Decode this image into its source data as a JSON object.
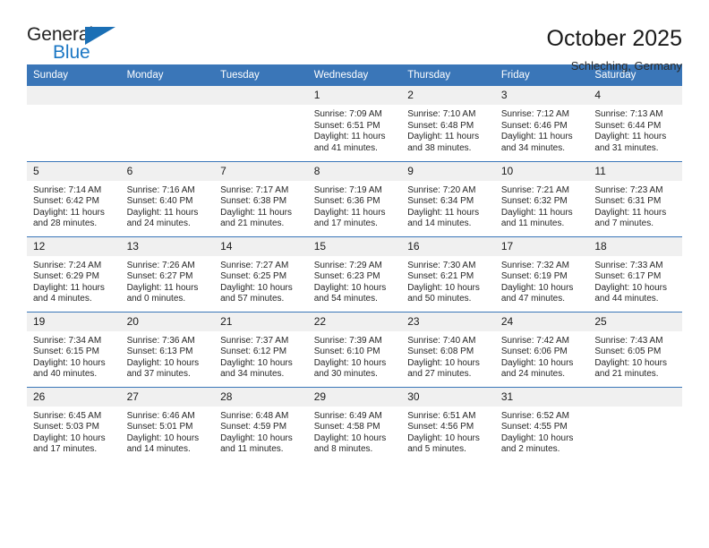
{
  "brand": {
    "name_top": "General",
    "name_bottom": "Blue",
    "flag_icon": "triangle-flag-icon",
    "color_top": "#222222",
    "color_bottom": "#1b77c4",
    "accent": "#3a76b8"
  },
  "header": {
    "month_title": "October 2025",
    "location": "Schleching, Germany"
  },
  "calendar": {
    "weekday_headers": [
      "Sunday",
      "Monday",
      "Tuesday",
      "Wednesday",
      "Thursday",
      "Friday",
      "Saturday"
    ],
    "header_bg": "#3a76b8",
    "daynum_bg": "#f0f0f0",
    "weeks": [
      [
        {
          "blank": true
        },
        {
          "blank": true
        },
        {
          "blank": true
        },
        {
          "day": "1",
          "sunrise": "Sunrise: 7:09 AM",
          "sunset": "Sunset: 6:51 PM",
          "daylight_1": "Daylight: 11 hours",
          "daylight_2": "and 41 minutes."
        },
        {
          "day": "2",
          "sunrise": "Sunrise: 7:10 AM",
          "sunset": "Sunset: 6:48 PM",
          "daylight_1": "Daylight: 11 hours",
          "daylight_2": "and 38 minutes."
        },
        {
          "day": "3",
          "sunrise": "Sunrise: 7:12 AM",
          "sunset": "Sunset: 6:46 PM",
          "daylight_1": "Daylight: 11 hours",
          "daylight_2": "and 34 minutes."
        },
        {
          "day": "4",
          "sunrise": "Sunrise: 7:13 AM",
          "sunset": "Sunset: 6:44 PM",
          "daylight_1": "Daylight: 11 hours",
          "daylight_2": "and 31 minutes."
        }
      ],
      [
        {
          "day": "5",
          "sunrise": "Sunrise: 7:14 AM",
          "sunset": "Sunset: 6:42 PM",
          "daylight_1": "Daylight: 11 hours",
          "daylight_2": "and 28 minutes."
        },
        {
          "day": "6",
          "sunrise": "Sunrise: 7:16 AM",
          "sunset": "Sunset: 6:40 PM",
          "daylight_1": "Daylight: 11 hours",
          "daylight_2": "and 24 minutes."
        },
        {
          "day": "7",
          "sunrise": "Sunrise: 7:17 AM",
          "sunset": "Sunset: 6:38 PM",
          "daylight_1": "Daylight: 11 hours",
          "daylight_2": "and 21 minutes."
        },
        {
          "day": "8",
          "sunrise": "Sunrise: 7:19 AM",
          "sunset": "Sunset: 6:36 PM",
          "daylight_1": "Daylight: 11 hours",
          "daylight_2": "and 17 minutes."
        },
        {
          "day": "9",
          "sunrise": "Sunrise: 7:20 AM",
          "sunset": "Sunset: 6:34 PM",
          "daylight_1": "Daylight: 11 hours",
          "daylight_2": "and 14 minutes."
        },
        {
          "day": "10",
          "sunrise": "Sunrise: 7:21 AM",
          "sunset": "Sunset: 6:32 PM",
          "daylight_1": "Daylight: 11 hours",
          "daylight_2": "and 11 minutes."
        },
        {
          "day": "11",
          "sunrise": "Sunrise: 7:23 AM",
          "sunset": "Sunset: 6:31 PM",
          "daylight_1": "Daylight: 11 hours",
          "daylight_2": "and 7 minutes."
        }
      ],
      [
        {
          "day": "12",
          "sunrise": "Sunrise: 7:24 AM",
          "sunset": "Sunset: 6:29 PM",
          "daylight_1": "Daylight: 11 hours",
          "daylight_2": "and 4 minutes."
        },
        {
          "day": "13",
          "sunrise": "Sunrise: 7:26 AM",
          "sunset": "Sunset: 6:27 PM",
          "daylight_1": "Daylight: 11 hours",
          "daylight_2": "and 0 minutes."
        },
        {
          "day": "14",
          "sunrise": "Sunrise: 7:27 AM",
          "sunset": "Sunset: 6:25 PM",
          "daylight_1": "Daylight: 10 hours",
          "daylight_2": "and 57 minutes."
        },
        {
          "day": "15",
          "sunrise": "Sunrise: 7:29 AM",
          "sunset": "Sunset: 6:23 PM",
          "daylight_1": "Daylight: 10 hours",
          "daylight_2": "and 54 minutes."
        },
        {
          "day": "16",
          "sunrise": "Sunrise: 7:30 AM",
          "sunset": "Sunset: 6:21 PM",
          "daylight_1": "Daylight: 10 hours",
          "daylight_2": "and 50 minutes."
        },
        {
          "day": "17",
          "sunrise": "Sunrise: 7:32 AM",
          "sunset": "Sunset: 6:19 PM",
          "daylight_1": "Daylight: 10 hours",
          "daylight_2": "and 47 minutes."
        },
        {
          "day": "18",
          "sunrise": "Sunrise: 7:33 AM",
          "sunset": "Sunset: 6:17 PM",
          "daylight_1": "Daylight: 10 hours",
          "daylight_2": "and 44 minutes."
        }
      ],
      [
        {
          "day": "19",
          "sunrise": "Sunrise: 7:34 AM",
          "sunset": "Sunset: 6:15 PM",
          "daylight_1": "Daylight: 10 hours",
          "daylight_2": "and 40 minutes."
        },
        {
          "day": "20",
          "sunrise": "Sunrise: 7:36 AM",
          "sunset": "Sunset: 6:13 PM",
          "daylight_1": "Daylight: 10 hours",
          "daylight_2": "and 37 minutes."
        },
        {
          "day": "21",
          "sunrise": "Sunrise: 7:37 AM",
          "sunset": "Sunset: 6:12 PM",
          "daylight_1": "Daylight: 10 hours",
          "daylight_2": "and 34 minutes."
        },
        {
          "day": "22",
          "sunrise": "Sunrise: 7:39 AM",
          "sunset": "Sunset: 6:10 PM",
          "daylight_1": "Daylight: 10 hours",
          "daylight_2": "and 30 minutes."
        },
        {
          "day": "23",
          "sunrise": "Sunrise: 7:40 AM",
          "sunset": "Sunset: 6:08 PM",
          "daylight_1": "Daylight: 10 hours",
          "daylight_2": "and 27 minutes."
        },
        {
          "day": "24",
          "sunrise": "Sunrise: 7:42 AM",
          "sunset": "Sunset: 6:06 PM",
          "daylight_1": "Daylight: 10 hours",
          "daylight_2": "and 24 minutes."
        },
        {
          "day": "25",
          "sunrise": "Sunrise: 7:43 AM",
          "sunset": "Sunset: 6:05 PM",
          "daylight_1": "Daylight: 10 hours",
          "daylight_2": "and 21 minutes."
        }
      ],
      [
        {
          "day": "26",
          "sunrise": "Sunrise: 6:45 AM",
          "sunset": "Sunset: 5:03 PM",
          "daylight_1": "Daylight: 10 hours",
          "daylight_2": "and 17 minutes."
        },
        {
          "day": "27",
          "sunrise": "Sunrise: 6:46 AM",
          "sunset": "Sunset: 5:01 PM",
          "daylight_1": "Daylight: 10 hours",
          "daylight_2": "and 14 minutes."
        },
        {
          "day": "28",
          "sunrise": "Sunrise: 6:48 AM",
          "sunset": "Sunset: 4:59 PM",
          "daylight_1": "Daylight: 10 hours",
          "daylight_2": "and 11 minutes."
        },
        {
          "day": "29",
          "sunrise": "Sunrise: 6:49 AM",
          "sunset": "Sunset: 4:58 PM",
          "daylight_1": "Daylight: 10 hours",
          "daylight_2": "and 8 minutes."
        },
        {
          "day": "30",
          "sunrise": "Sunrise: 6:51 AM",
          "sunset": "Sunset: 4:56 PM",
          "daylight_1": "Daylight: 10 hours",
          "daylight_2": "and 5 minutes."
        },
        {
          "day": "31",
          "sunrise": "Sunrise: 6:52 AM",
          "sunset": "Sunset: 4:55 PM",
          "daylight_1": "Daylight: 10 hours",
          "daylight_2": "and 2 minutes."
        },
        {
          "blank": true
        }
      ]
    ]
  }
}
